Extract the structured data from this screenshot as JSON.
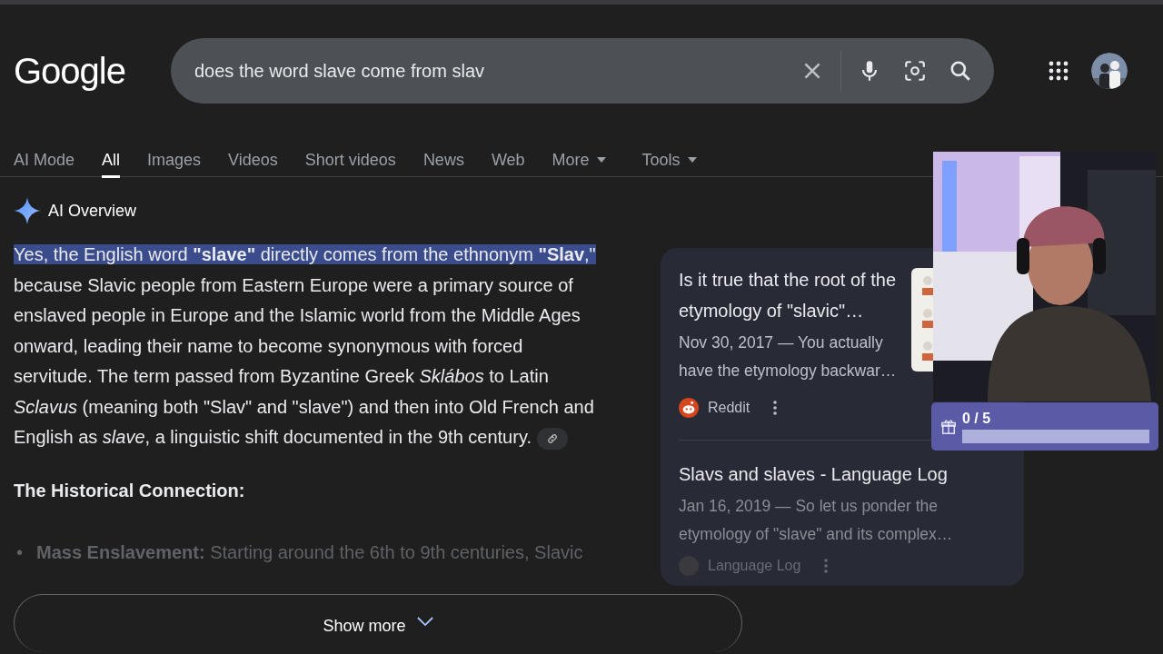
{
  "header": {
    "logo": "Google",
    "query": "does the word slave come from slav"
  },
  "tabs": [
    {
      "label": "AI Mode",
      "selected": false,
      "dropdown": false
    },
    {
      "label": "All",
      "selected": true,
      "dropdown": false
    },
    {
      "label": "Images",
      "selected": false,
      "dropdown": false
    },
    {
      "label": "Videos",
      "selected": false,
      "dropdown": false
    },
    {
      "label": "Short videos",
      "selected": false,
      "dropdown": false
    },
    {
      "label": "News",
      "selected": false,
      "dropdown": false
    },
    {
      "label": "Web",
      "selected": false,
      "dropdown": false
    },
    {
      "label": "More",
      "selected": false,
      "dropdown": true
    },
    {
      "label": "Tools",
      "selected": false,
      "dropdown": true
    }
  ],
  "ai_overview": {
    "title": "AI Overview",
    "paragraph": [
      {
        "text": "Yes, the English word **\"slave\"** directly comes from the ethnonym **\"Slav**,\"",
        "selected": true
      },
      {
        "text": " because Slavic people from Eastern Europe were a primary source of enslaved people in Europe and the Islamic world from the Middle Ages onward, leading their name to become synonymous with forced servitude. The term passed from Byzantine Greek *Sklábos* to Latin *Sclavus* (meaning both \"Slav\" and \"slave\") and then into Old French and English as *slave*, a linguistic shift documented in the 9th century.",
        "selected": false
      }
    ],
    "heading": "The Historical Connection:",
    "bullets": [
      {
        "marker": "•",
        "text": "**Mass Enslavement:** Starting around the 6th to 9th centuries, Slavic"
      }
    ],
    "show_more": "Show more"
  },
  "sources": [
    {
      "title": "Is it true that the root of the etymology of \"slavic\"…",
      "snippet": "Nov 30, 2017 — You actually have the etymology backwar…",
      "site": "Reddit",
      "thumbnail": true,
      "faded": false
    },
    {
      "title": "Slavs and slaves - Language Log",
      "snippet": "Jan 16, 2019 — So let us ponder the etymology of \"slave\" and its complex…",
      "site": "Language Log",
      "thumbnail": false,
      "faded": true
    }
  ],
  "overlay": {
    "goal": {
      "count": "0 / 5",
      "level": 0
    }
  }
}
